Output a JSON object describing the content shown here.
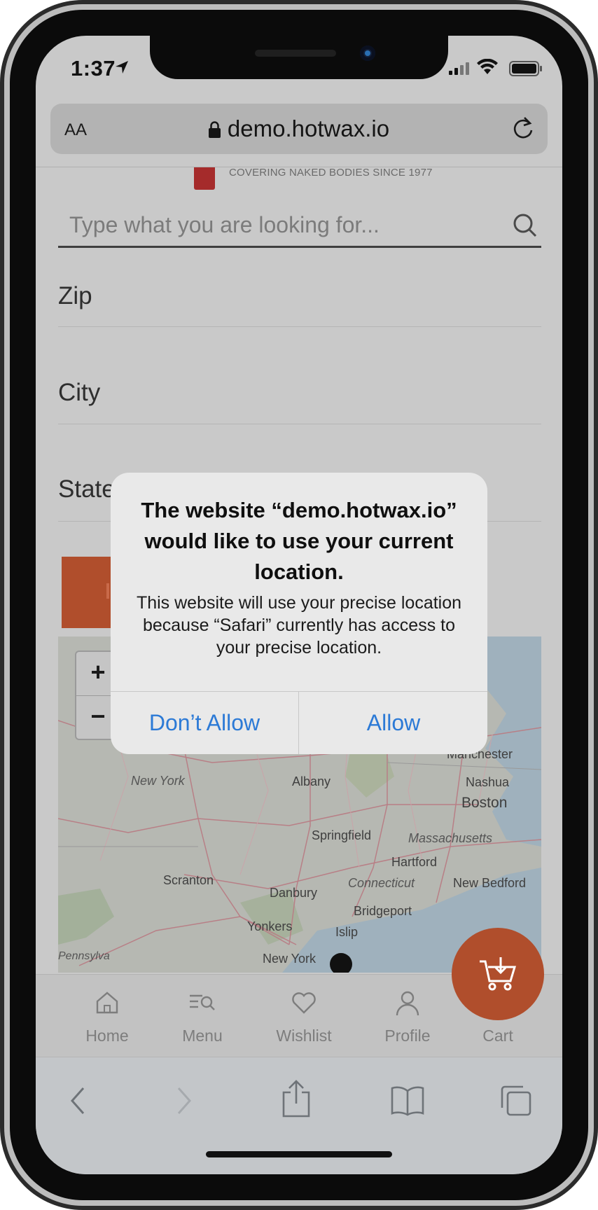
{
  "status_bar": {
    "time": "1:37"
  },
  "browser": {
    "text_size_label": "AA",
    "url": "demo.hotwax.io"
  },
  "page": {
    "tagline": "COVERING NAKED BODIES SINCE 1977",
    "search_placeholder": "Type what you are looking for...",
    "fields": [
      "Zip",
      "City",
      "State"
    ],
    "map": {
      "zoom_in": "+",
      "zoom_out": "−",
      "labels": [
        "Albany",
        "New York",
        "Nashua",
        "Boston",
        "Manchester",
        "Springfield",
        "Massachusetts",
        "Hartford",
        "Scranton",
        "Danbury",
        "Connecticut",
        "New Bedford",
        "Bridgeport",
        "Yonkers",
        "Islip",
        "New York",
        "Pennsylvania"
      ]
    }
  },
  "tabs": [
    {
      "label": "Home",
      "icon": "home-icon"
    },
    {
      "label": "Menu",
      "icon": "menu-search-icon"
    },
    {
      "label": "Wishlist",
      "icon": "heart-icon"
    },
    {
      "label": "Profile",
      "icon": "person-icon"
    },
    {
      "label": "Cart",
      "icon": "cart-icon"
    }
  ],
  "alert": {
    "title": "The website “demo.hotwax.io” would like to use your current location.",
    "message": "This website will use your precise location because “Safari” currently has access to your precise location.",
    "deny_label": "Don’t Allow",
    "allow_label": "Allow"
  },
  "colors": {
    "accent": "#B04E2C",
    "alert_button": "#2C7AD6"
  }
}
